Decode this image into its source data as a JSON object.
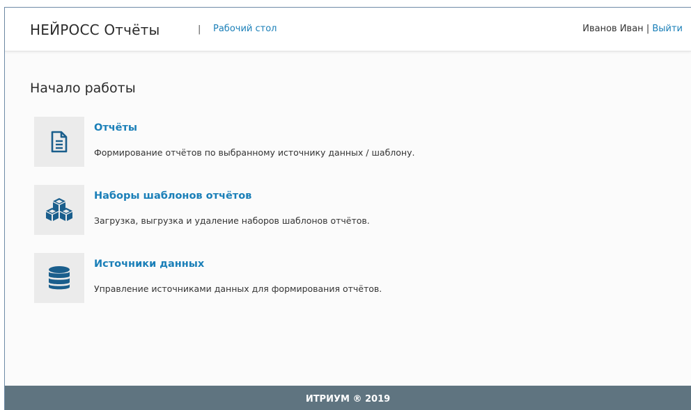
{
  "header": {
    "brand": "НЕЙРОСС Отчёты",
    "separator": "|",
    "desk_link": "Рабочий стол",
    "user_name": "Иванов Иван",
    "user_separator": " | ",
    "logout": "Выйти"
  },
  "main": {
    "title": "Начало работы",
    "items": [
      {
        "icon": "document-icon",
        "title": "Отчёты",
        "description": "Формирование отчётов по выбранному источнику данных / шаблону."
      },
      {
        "icon": "cubes-icon",
        "title": "Наборы шаблонов отчётов",
        "description": "Загрузка, выгрузка и удаление наборов шаблонов отчётов."
      },
      {
        "icon": "database-icon",
        "title": "Источники данных",
        "description": "Управление источниками данных для формирования отчётов."
      }
    ]
  },
  "footer": {
    "text": "ИТРИУМ ® 2019"
  },
  "colors": {
    "link": "#1a7fb8",
    "icon": "#1a5e8c",
    "footer_bg": "#5f7480"
  }
}
